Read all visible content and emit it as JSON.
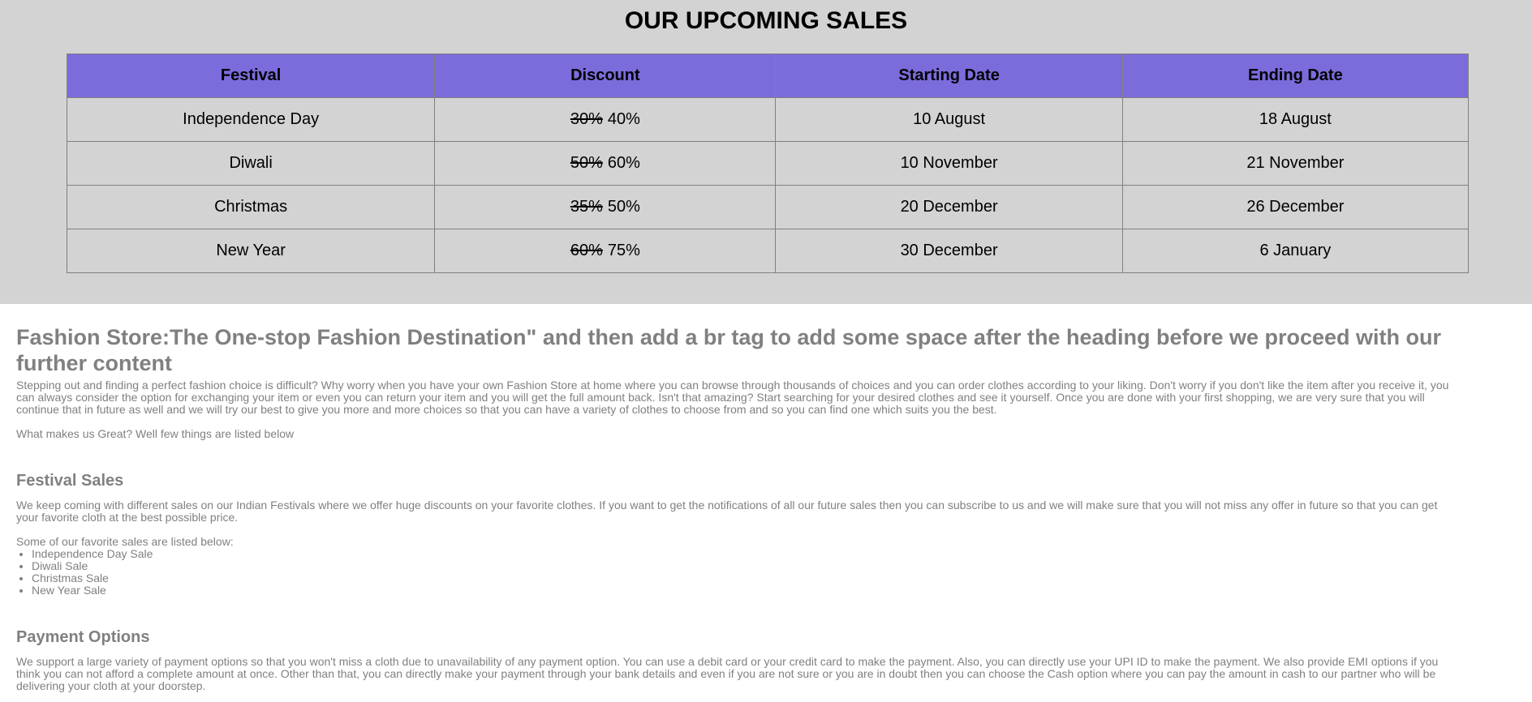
{
  "sales": {
    "title": "OUR UPCOMING SALES",
    "headers": [
      "Festival",
      "Discount",
      "Starting Date",
      "Ending Date"
    ],
    "rows": [
      {
        "festival": "Independence Day",
        "old_discount": "30%",
        "new_discount": "40%",
        "start": "10 August",
        "end": "18 August"
      },
      {
        "festival": "Diwali",
        "old_discount": "50%",
        "new_discount": "60%",
        "start": "10 November",
        "end": "21 November"
      },
      {
        "festival": "Christmas",
        "old_discount": "35%",
        "new_discount": "50%",
        "start": "20 December",
        "end": "26 December"
      },
      {
        "festival": "New Year",
        "old_discount": "60%",
        "new_discount": "75%",
        "start": "30 December",
        "end": "6 January"
      }
    ]
  },
  "content": {
    "heading": "Fashion Store:The One-stop Fashion Destination\" and then add a br tag to add some space after the heading before we proceed with our further content",
    "intro": "Stepping out and finding a perfect fashion choice is difficult? Why worry when you have your own Fashion Store at home where you can browse through thousands of choices and you can order clothes according to your liking. Don't worry if you don't like the item after you receive it, you can always consider the option for exchanging your item or even you can return your item and you will get the full amount back. Isn't that amazing? Start searching for your desired clothes and see it yourself. Once you are done with your first shopping, we are very sure that you will continue that in future as well and we will try our best to give you more and more choices so that you can have a variety of clothes to choose from and so you can find one which suits you the best.",
    "great_line": "What makes us Great? Well few things are listed below",
    "festival": {
      "heading": "Festival Sales",
      "text": "We keep coming with different sales on our Indian Festivals where we offer huge discounts on your favorite clothes. If you want to get the notifications of all our future sales then you can subscribe to us and we will make sure that you will not miss any offer in future so that you can get your favorite cloth at the best possible price.",
      "list_intro": "Some of our favorite sales are listed below:",
      "items": [
        "Independence Day Sale",
        "Diwali Sale",
        "Christmas Sale",
        "New Year Sale"
      ]
    },
    "payment": {
      "heading": "Payment Options",
      "text": "We support a large variety of payment options so that you won't miss a cloth due to unavailability of any payment option. You can use a debit card or your credit card to make the payment. Also, you can directly use your UPI ID to make the payment. We also provide EMI options if you think you can not afford a complete amount at once. Other than that, you can directly make your payment through your bank details and even if you are not sure or you are in doubt then you can choose the Cash option where you can pay the amount in cash to our partner who will be delivering your cloth at your doorstep."
    }
  },
  "colors": {
    "header_bg": "#7b6cdc",
    "section_bg": "#d3d3d3",
    "text_gray": "#808080"
  }
}
